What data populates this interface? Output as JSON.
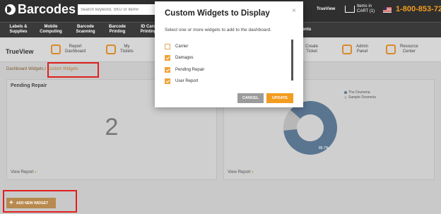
{
  "header": {
    "brand": "Barcodes",
    "search_placeholder": "Search keyword, SKU or item#",
    "trueview_link": "TrueView",
    "cart_label": "Items in",
    "cart_count": "CART (1)",
    "phone": "1-800-853-72"
  },
  "nav": {
    "items": [
      {
        "line1": "Labels &",
        "line2": "Supplies"
      },
      {
        "line1": "Mobile",
        "line2": "Computing"
      },
      {
        "line1": "Barcode",
        "line2": "Scanning"
      },
      {
        "line1": "Barcode",
        "line2": "Printing"
      },
      {
        "line1": "ID Card",
        "line2": "Printing"
      }
    ],
    "partial_right": "ents"
  },
  "trueview": {
    "title": "TrueView",
    "items": [
      {
        "icon": "report-dashboard-icon",
        "line1": "Report",
        "line2": "Dashboard"
      },
      {
        "icon": "my-tickets-icon",
        "line1": "My",
        "line2": "Tickets"
      },
      {
        "icon": "create-ticket-icon",
        "line1": "Create",
        "line2": "Ticket"
      },
      {
        "icon": "admin-panel-icon",
        "line1": "Admin",
        "line2": "Panel"
      },
      {
        "icon": "resource-center-icon",
        "line1": "Resource",
        "line2": "Center"
      }
    ]
  },
  "breadcrumb": {
    "root": "Dashboard Widgets",
    "separator": "/",
    "current": "Custom Widgets"
  },
  "cards": {
    "pending_repair": {
      "title": "Pending Repair",
      "value": "2",
      "link": "View Report",
      "arrow": "›"
    },
    "chart_card": {
      "link": "View Report",
      "arrow": "›"
    }
  },
  "chart_data": {
    "type": "pie",
    "series": [
      {
        "name": "The Drumeria",
        "value": 86.7,
        "label": "86.7%"
      },
      {
        "name": "Sample Drumeria",
        "value": 13.3,
        "label": ""
      }
    ],
    "colors": [
      "#5a7590",
      "#b7b7b7"
    ]
  },
  "add_widget_label": "ADD NEW WIDGET",
  "modal": {
    "title": "Custom Widgets to Display",
    "close": "×",
    "subtitle": "Select one or more widgets to add to the dashboard.",
    "options": [
      {
        "label": "Carrier",
        "checked": false
      },
      {
        "label": "Damages",
        "checked": true
      },
      {
        "label": "Pending Repair",
        "checked": true
      },
      {
        "label": "User Report",
        "checked": true
      }
    ],
    "cancel_label": "CANCEL",
    "update_label": "UPDATE"
  },
  "colors": {
    "accent": "#f39c1f",
    "highlight": "#e02020",
    "topbar": "#2f2f2f"
  }
}
